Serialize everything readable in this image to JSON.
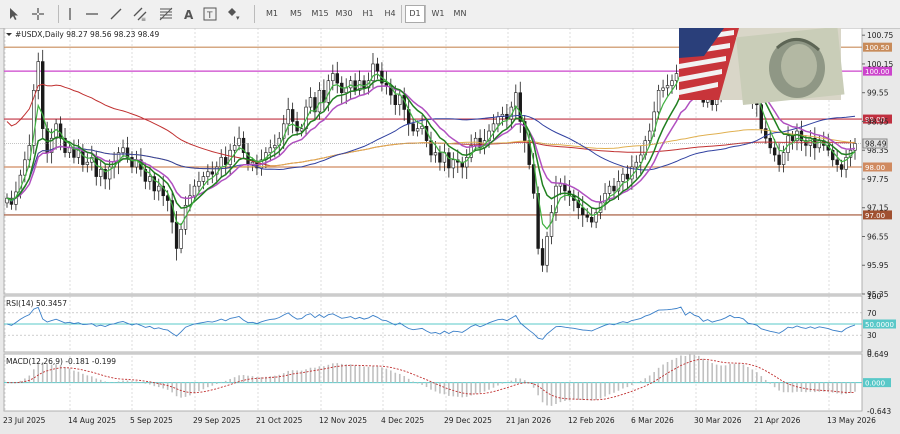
{
  "toolbar": {
    "timeframes": [
      "M1",
      "M5",
      "M15",
      "M30",
      "H1",
      "H4",
      "D1",
      "W1",
      "MN"
    ],
    "active_timeframe": "D1",
    "tools": [
      "cursor-icon",
      "crosshair-icon",
      "vertical-line-icon",
      "horizontal-line-icon",
      "trend-line-icon",
      "channel-icon",
      "fibonacci-icon",
      "text-icon",
      "text-label-icon",
      "shapes-icon"
    ]
  },
  "chart_data": {
    "type": "candlestick",
    "symbol_info": "#USDX,Daily  98.27 98.56 98.23 98.49",
    "x_tick_labels": [
      "23 Jul 2025",
      "14 Aug 2025",
      "5 Sep 2025",
      "29 Sep 2025",
      "21 Oct 2025",
      "12 Nov 2025",
      "4 Dec 2025",
      "29 Dec 2025",
      "21 Jan 2026",
      "12 Feb 2026",
      "6 Mar 2026",
      "30 Mar 2026",
      "21 Apr 2026",
      "13 May 2026"
    ],
    "y_ticks": [
      "100.75",
      "100.15",
      "99.55",
      "98.95",
      "98.35",
      "97.75",
      "97.15",
      "96.55",
      "95.95",
      "95.35"
    ],
    "ylim": [
      95.35,
      100.9
    ],
    "current_price": "98.49",
    "levels": [
      {
        "value": 100.5,
        "label": "100.50",
        "color": "#c88b5a"
      },
      {
        "value": 100.0,
        "label": "100.00",
        "color": "#cc44cc"
      },
      {
        "value": 99.0,
        "label": "99.00",
        "color": "#c03040"
      },
      {
        "value": 98.0,
        "label": "98.00",
        "color": "#d08a60"
      },
      {
        "value": 97.0,
        "label": "97.00",
        "color": "#a05030"
      }
    ],
    "closes": [
      97.35,
      97.22,
      97.48,
      97.83,
      98.15,
      98.45,
      99.6,
      100.2,
      98.8,
      98.3,
      98.6,
      98.9,
      98.6,
      98.3,
      98.4,
      98.2,
      98.35,
      98.05,
      98.1,
      98.2,
      97.8,
      97.95,
      97.75,
      98.0,
      98.1,
      98.3,
      98.4,
      98.2,
      98.0,
      98.15,
      97.95,
      97.7,
      97.8,
      97.5,
      97.6,
      97.4,
      97.3,
      96.85,
      96.3,
      96.7,
      97.2,
      97.4,
      97.6,
      97.7,
      97.8,
      97.9,
      97.85,
      98.0,
      98.2,
      98.05,
      98.35,
      98.45,
      98.6,
      98.3,
      98.05,
      98.1,
      97.98,
      98.15,
      98.3,
      98.4,
      98.45,
      98.6,
      98.9,
      99.2,
      98.95,
      98.75,
      98.8,
      99.25,
      99.45,
      99.15,
      99.6,
      99.35,
      99.8,
      99.95,
      99.75,
      99.55,
      99.65,
      99.8,
      99.6,
      99.8,
      99.65,
      99.8,
      100.15,
      100.0,
      99.75,
      99.7,
      99.5,
      99.3,
      99.5,
      99.2,
      98.9,
      98.75,
      98.8,
      98.85,
      98.55,
      98.25,
      98.3,
      98.1,
      98.3,
      97.98,
      98.15,
      98.1,
      98.0,
      98.2,
      98.45,
      98.6,
      98.4,
      98.55,
      98.75,
      98.9,
      99.05,
      99.1,
      99.0,
      99.25,
      99.55,
      98.95,
      98.55,
      98.05,
      97.45,
      96.3,
      95.95,
      96.55,
      97.05,
      97.6,
      97.65,
      97.5,
      97.4,
      97.3,
      97.15,
      97.0,
      96.95,
      96.85,
      97.05,
      97.25,
      97.45,
      97.6,
      97.5,
      97.7,
      97.85,
      97.75,
      98.0,
      98.1,
      98.25,
      98.55,
      98.75,
      99.15,
      99.6,
      99.65,
      99.7,
      99.8,
      99.95,
      100.3,
      99.7,
      100.3,
      100.0,
      99.85,
      99.35,
      99.6,
      99.3,
      99.5,
      99.65,
      99.95,
      100.4,
      100.15,
      100.2,
      100.05,
      99.55,
      99.45,
      99.3,
      98.8,
      98.6,
      98.4,
      98.25,
      98.05,
      98.3,
      98.65,
      98.55,
      98.75,
      98.55,
      98.45,
      98.6,
      98.4,
      98.55,
      98.45,
      98.35,
      98.15,
      98.05,
      97.95,
      98.2,
      98.35,
      98.49
    ],
    "rsi": {
      "label": "RSI(14) 50.3457",
      "ticks": [
        "100",
        "70",
        "50",
        "30",
        "0"
      ],
      "current": "50.0000"
    },
    "macd": {
      "label": "MACD(12,26,9) -0.181 -0.199",
      "ticks": [
        "0.649",
        "0.000",
        "-0.643"
      ],
      "current": "0.000"
    }
  }
}
